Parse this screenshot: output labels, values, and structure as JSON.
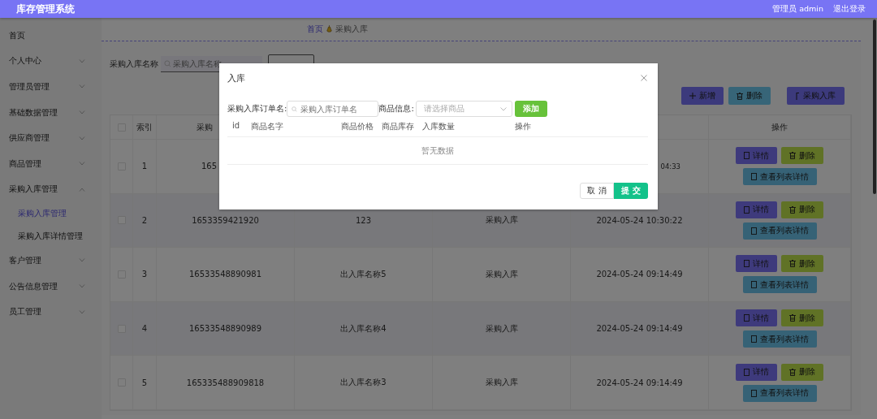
{
  "header": {
    "title": "库存管理系统",
    "user": "管理员 admin",
    "logout": "退出登录"
  },
  "sidebar": {
    "items": [
      {
        "label": "首页",
        "kind": "link"
      },
      {
        "label": "个人中心",
        "kind": "menu",
        "expanded": false
      },
      {
        "label": "管理员管理",
        "kind": "menu",
        "expanded": false
      },
      {
        "label": "基础数据管理",
        "kind": "menu",
        "expanded": false
      },
      {
        "label": "供应商管理",
        "kind": "menu",
        "expanded": false
      },
      {
        "label": "商品管理",
        "kind": "menu",
        "expanded": false
      },
      {
        "label": "采购入库管理",
        "kind": "menu",
        "expanded": true,
        "children": [
          {
            "label": "采购入库管理",
            "selected": true
          },
          {
            "label": "采购入库详情管理",
            "selected": false
          }
        ]
      },
      {
        "label": "客户管理",
        "kind": "menu",
        "expanded": false
      },
      {
        "label": "公告信息管理",
        "kind": "menu",
        "expanded": false
      },
      {
        "label": "员工管理",
        "kind": "menu",
        "expanded": false
      }
    ]
  },
  "breadcrumb": [
    "首页",
    "采购入库"
  ],
  "search": {
    "label": "采购入库名称",
    "placeholder": "采购入库名称"
  },
  "toolbar": [
    {
      "label": "新增",
      "kind": "add"
    },
    {
      "label": "删除",
      "kind": "delete"
    },
    {
      "label": "采购入库",
      "kind": "stock"
    }
  ],
  "table": {
    "columns": [
      "索引",
      "采购",
      "操作"
    ],
    "header_checked": false,
    "rows": [
      {
        "index": "1",
        "number": "165",
        "time": "04:33",
        "partial": true,
        "checked": false,
        "actions": {
          "detail": "详情",
          "delete": "删除",
          "list": "查看列表详情"
        }
      },
      {
        "index": "2",
        "number": "1653359421920",
        "name": "123",
        "type": "采购入库",
        "time": "2024-05-24 10:30:22",
        "partial": false,
        "checked": false,
        "actions": {
          "detail": "详情",
          "delete": "删除",
          "list": "查看列表详情"
        }
      },
      {
        "index": "3",
        "number": "16533548890981",
        "name": "出入库名称5",
        "type": "采购入库",
        "time": "2024-05-24 09:14:49",
        "partial": false,
        "checked": false,
        "actions": {
          "detail": "详情",
          "delete": "删除",
          "list": "查看列表详情"
        }
      },
      {
        "index": "4",
        "number": "16533548890989",
        "name": "出入库名称4",
        "type": "采购入库",
        "time": "2024-05-24 09:14:49",
        "partial": false,
        "checked": false,
        "actions": {
          "detail": "详情",
          "delete": "删除",
          "list": "查看列表详情"
        }
      },
      {
        "index": "5",
        "number": "165335488909818",
        "name": "出入库名称3",
        "type": "采购入库",
        "time": "2024-05-24 09:14:49",
        "partial": false,
        "checked": false,
        "actions": {
          "detail": "详情",
          "delete": "删除",
          "list": "查看列表详情"
        }
      }
    ]
  },
  "dialog": {
    "title": "入库",
    "order_label": "采购入库订单名:",
    "order_placeholder": "采购入库订单名",
    "goods_label": "商品信息:",
    "goods_placeholder": "请选择商品",
    "add": "添加",
    "columns": [
      "id",
      "商品名字",
      "商品价格",
      "商品库存",
      "入库数量",
      "操作"
    ],
    "empty": "暂无数据",
    "cancel": "取 消",
    "submit": "提 交"
  }
}
